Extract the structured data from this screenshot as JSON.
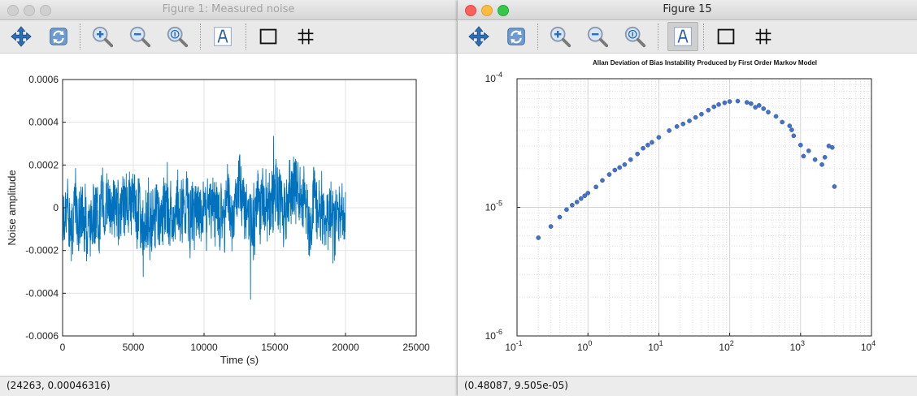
{
  "windows": [
    {
      "title": "Figure 1: Measured noise",
      "status": "(24263, 0.00046316)",
      "chart_data": {
        "type": "line",
        "title": "",
        "xlabel": "Time (s)",
        "ylabel": "Noise amplitude",
        "xlim": [
          0,
          25000
        ],
        "ylim": [
          -0.0006,
          0.0006
        ],
        "grid": true,
        "x_ticks": [
          0,
          5000,
          10000,
          15000,
          20000,
          25000
        ],
        "x_tick_labels": [
          "0",
          "5000",
          "10000",
          "15000",
          "20000",
          "25000"
        ],
        "y_ticks": [
          0.0006,
          0.0004,
          0.0002,
          0,
          -0.0002,
          -0.0004,
          -0.0006
        ],
        "y_tick_labels": [
          "0.0006",
          "0.0004",
          "0.0002",
          "0",
          "-0.0002",
          "-0.0004",
          "-0.0006"
        ],
        "series": [
          {
            "color": "#0072bd",
            "x_range": [
              0,
              20000
            ],
            "y_min": -0.00043,
            "y_max": 0.00042
          }
        ]
      }
    },
    {
      "title": "Figure 15",
      "status": "(0.48087, 9.505e-05)",
      "chart_data": {
        "type": "scatter",
        "title": "Allan Deviation of Bias Instability Produced by First Order Markov Model",
        "xlabel": "",
        "ylabel": "",
        "x_scale": "log",
        "y_scale": "log",
        "xlim": [
          0.1,
          10000
        ],
        "ylim": [
          1e-06,
          0.0001
        ],
        "grid": true,
        "x_ticks": [
          0.1,
          1,
          10,
          100,
          1000,
          10000
        ],
        "x_tick_labels": [
          [
            "10",
            "-1"
          ],
          [
            "10",
            "0"
          ],
          [
            "10",
            "1"
          ],
          [
            "10",
            "2"
          ],
          [
            "10",
            "3"
          ],
          [
            "10",
            "4"
          ]
        ],
        "y_ticks": [
          0.0001,
          1e-05,
          1e-06
        ],
        "y_tick_labels": [
          [
            "10",
            "-4"
          ],
          [
            "10",
            "-5"
          ],
          [
            "10",
            "-6"
          ]
        ],
        "series": [
          {
            "color": "#4472c4",
            "points": [
              [
                0.2,
                5.8e-06
              ],
              [
                0.3,
                7.1e-06
              ],
              [
                0.4,
                8.4e-06
              ],
              [
                0.5,
                9.6e-06
              ],
              [
                0.6,
                1.04e-05
              ],
              [
                0.7,
                1.1e-05
              ],
              [
                0.8,
                1.17e-05
              ],
              [
                0.9,
                1.23e-05
              ],
              [
                1.0,
                1.29e-05
              ],
              [
                1.3,
                1.44e-05
              ],
              [
                1.6,
                1.62e-05
              ],
              [
                2.0,
                1.8e-05
              ],
              [
                2.4,
                1.95e-05
              ],
              [
                2.8,
                2.04e-05
              ],
              [
                3.3,
                2.15e-05
              ],
              [
                4.0,
                2.35e-05
              ],
              [
                5.0,
                2.6e-05
              ],
              [
                6.0,
                2.88e-05
              ],
              [
                7.0,
                3.05e-05
              ],
              [
                8.0,
                3.2e-05
              ],
              [
                10,
                3.5e-05
              ],
              [
                14,
                3.95e-05
              ],
              [
                18,
                4.25e-05
              ],
              [
                22,
                4.45e-05
              ],
              [
                27,
                4.7e-05
              ],
              [
                33,
                5e-05
              ],
              [
                40,
                5.3e-05
              ],
              [
                50,
                5.7e-05
              ],
              [
                60,
                6.05e-05
              ],
              [
                70,
                6.3e-05
              ],
              [
                85,
                6.5e-05
              ],
              [
                100,
                6.65e-05
              ],
              [
                130,
                6.7e-05
              ],
              [
                175,
                6.55e-05
              ],
              [
                200,
                6.4e-05
              ],
              [
                230,
                6e-05
              ],
              [
                260,
                6.2e-05
              ],
              [
                300,
                5.85e-05
              ],
              [
                350,
                5.5e-05
              ],
              [
                450,
                5.1e-05
              ],
              [
                550,
                4.6e-05
              ],
              [
                700,
                4.3e-05
              ],
              [
                750,
                4e-05
              ],
              [
                800,
                3.6e-05
              ],
              [
                1000,
                3.05e-05
              ],
              [
                1100,
                2.5e-05
              ],
              [
                1300,
                2.75e-05
              ],
              [
                1600,
                2.35e-05
              ],
              [
                2000,
                2.15e-05
              ],
              [
                2200,
                2.45e-05
              ],
              [
                2500,
                3e-05
              ],
              [
                2800,
                2.92e-05
              ],
              [
                3000,
                1.45e-05
              ]
            ]
          }
        ]
      }
    }
  ],
  "toolbar": [
    "pan-icon",
    "rotate-icon",
    "zoom-in-icon",
    "zoom-out-icon",
    "zoom-reset-icon",
    "text-tool-icon",
    "box-icon",
    "grid-icon"
  ]
}
